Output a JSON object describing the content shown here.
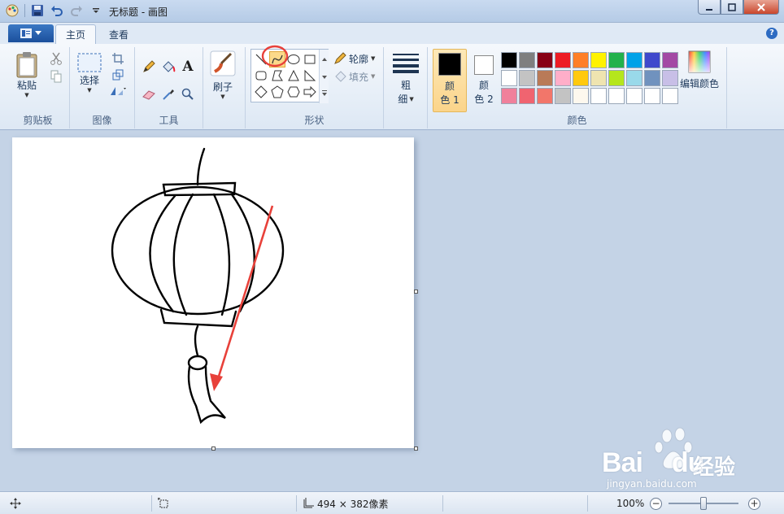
{
  "titlebar": {
    "title": "无标题 - 画图",
    "icons": [
      "paint-app-icon",
      "save-icon",
      "undo-icon",
      "redo-icon",
      "qat-dropdown-icon"
    ],
    "controls": [
      "minimize-icon",
      "maximize-icon",
      "close-icon"
    ]
  },
  "tabs": {
    "home": "主页",
    "view": "查看"
  },
  "ribbon": {
    "clipboard": {
      "paste": "粘贴",
      "group": "剪贴板"
    },
    "image": {
      "select": "选择",
      "group": "图像"
    },
    "tools": {
      "group": "工具",
      "text_icon": "A"
    },
    "brushes": {
      "label": "刷子"
    },
    "shapes": {
      "group": "形状",
      "outline": "轮廓",
      "fill": "填充",
      "selected": "curve"
    },
    "size": {
      "label_line1": "粗",
      "label_line2": "细"
    },
    "colors": {
      "group": "颜色",
      "color1_line1": "颜",
      "color1_line2": "色 1",
      "color2_line1": "颜",
      "color2_line2": "色 2",
      "color1_value": "#000000",
      "color2_value": "#ffffff",
      "edit": "编辑颜色",
      "palette": [
        "#000000",
        "#7f7f7f",
        "#880015",
        "#ed1c24",
        "#ff7f27",
        "#fff200",
        "#22b14c",
        "#00a2e8",
        "#3f48cc",
        "#a349a4",
        "#ffffff",
        "#c3c3c3",
        "#b97a57",
        "#ffaec9",
        "#ffc90e",
        "#efe4b0",
        "#b5e61d",
        "#99d9ea",
        "#7092be",
        "#c8bfe7",
        "#f0809b",
        "#f06470",
        "#f2766a",
        "#c3c3c3",
        "#fdf8ee",
        "#ffffff",
        "#ffffff",
        "#ffffff",
        "#ffffff",
        "#ffffff"
      ]
    }
  },
  "status": {
    "dimensions": "494 × 382像素",
    "zoom": "100%",
    "zoom_minus": "−",
    "zoom_plus": "+",
    "zoom_level": 0.5
  },
  "watermark": {
    "brand": "Bai",
    "brand2": "du",
    "cn": "经验",
    "url": "jingyan.baidu.com"
  }
}
